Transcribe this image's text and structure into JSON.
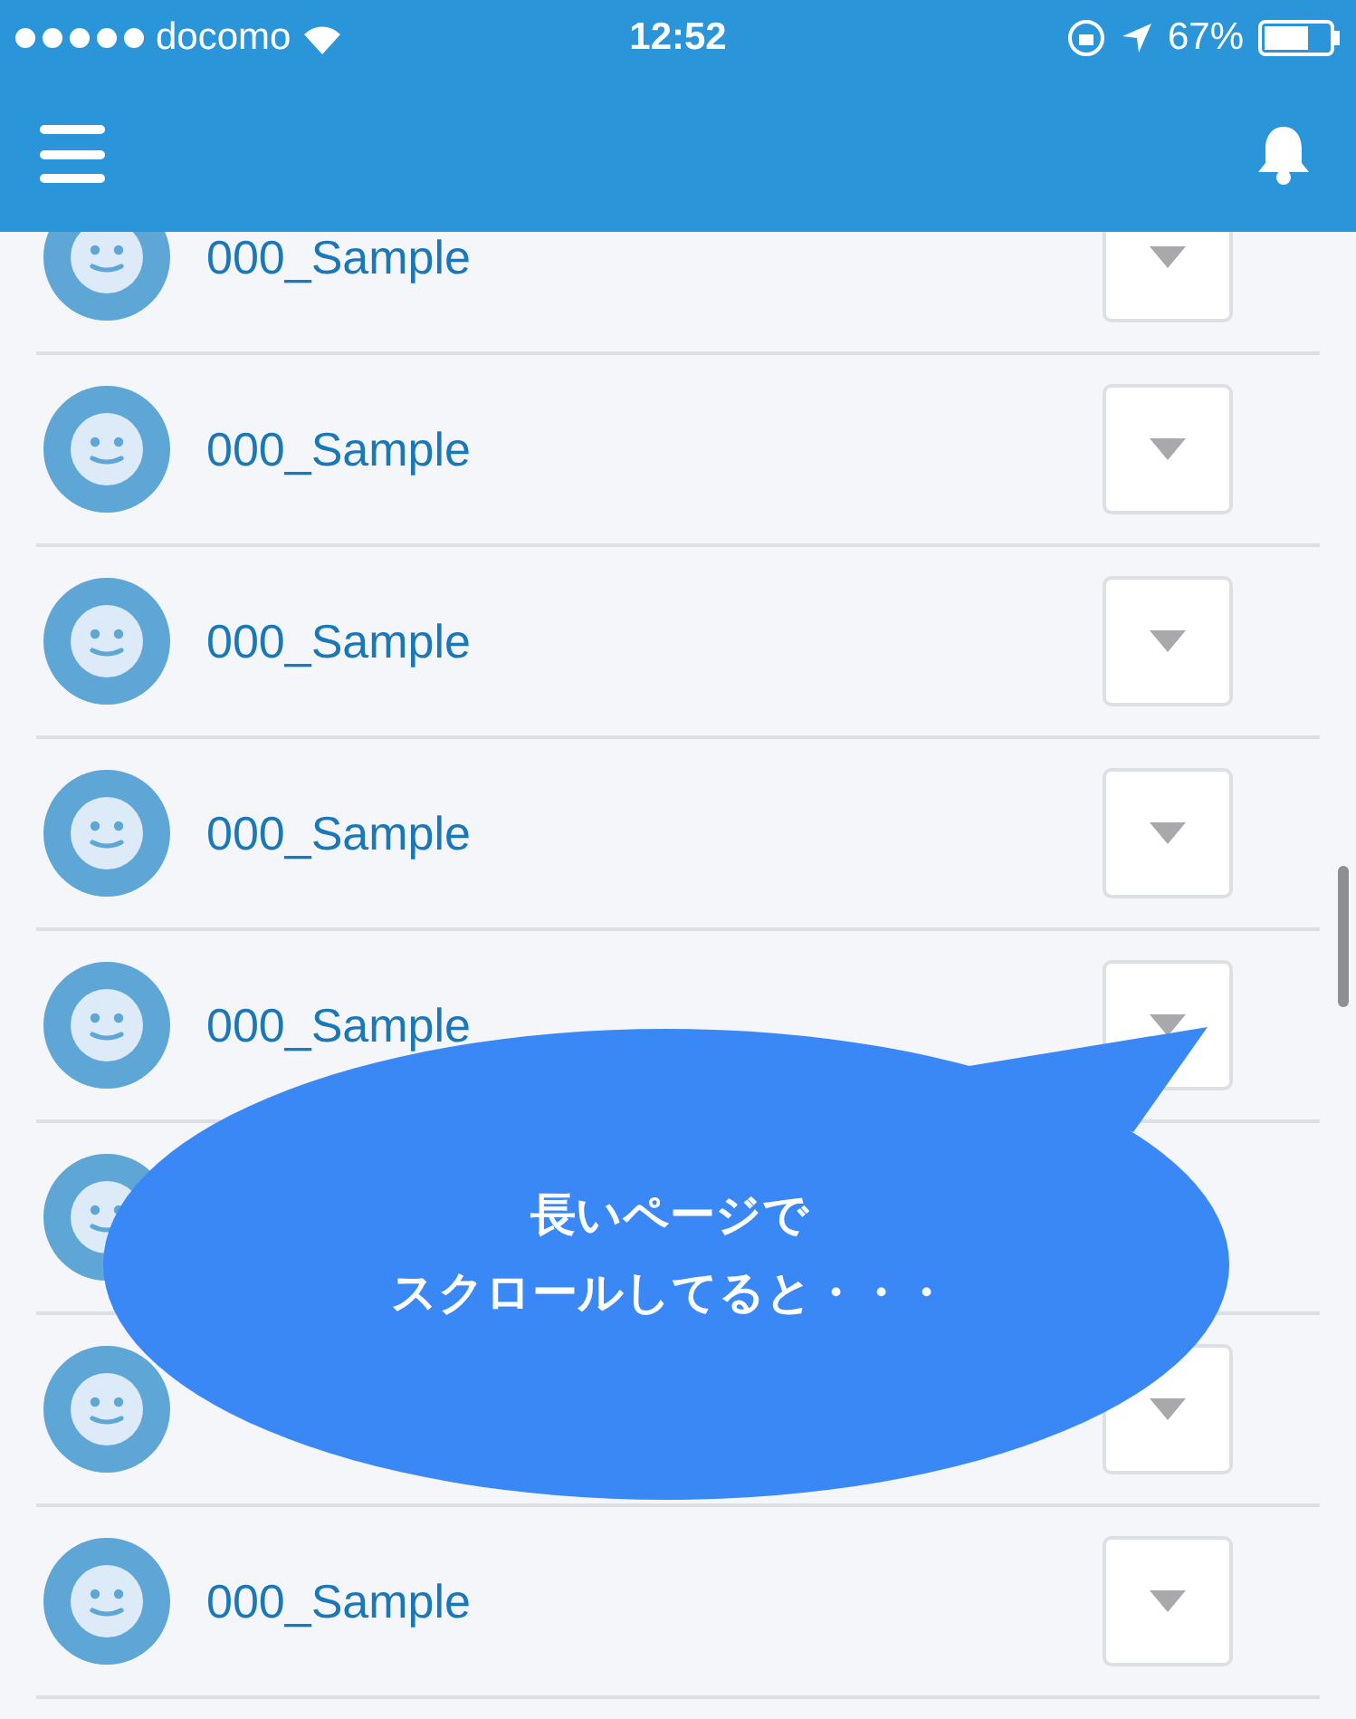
{
  "status_bar": {
    "carrier": "docomo",
    "time": "12:52",
    "battery": "67%"
  },
  "rows": [
    {
      "name": "000_Sample"
    },
    {
      "name": "000_Sample"
    },
    {
      "name": "000_Sample"
    },
    {
      "name": "000_Sample"
    },
    {
      "name": "000_Sample"
    },
    {
      "kind": "avatar"
    },
    {
      "kind": "avatar_button"
    },
    {
      "name": "000_Sample"
    }
  ],
  "callout": {
    "lines": [
      "長いページで",
      "スクロールしてると・・・"
    ]
  }
}
